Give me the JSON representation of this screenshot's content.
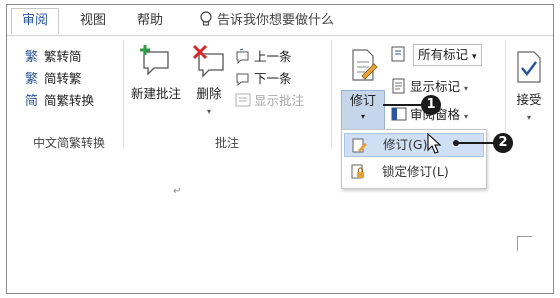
{
  "tabs": {
    "review": "审阅",
    "view": "视图",
    "help": "帮助"
  },
  "tell_me": "告诉我你想要做什么",
  "chinese_conversion": {
    "to_simplified": "繁转简",
    "to_traditional": "简转繁",
    "convert": "简繁转换",
    "group_label": "中文简繁转换"
  },
  "comments": {
    "new_comment": "新建批注",
    "delete": "删除",
    "previous": "上一条",
    "next": "下一条",
    "show_comments": "显示批注",
    "group_label": "批注"
  },
  "tracking": {
    "track_changes": "修订",
    "all_markup": "所有标记",
    "show_markup": "显示标记",
    "reviewing_pane": "审阅窗格"
  },
  "accept": "接受",
  "menu": {
    "track_changes": "修订(G)",
    "lock_tracking": "锁定修订(L)"
  },
  "callouts": {
    "one": "1",
    "two": "2"
  },
  "doc": {
    "para_mark": "↵"
  }
}
